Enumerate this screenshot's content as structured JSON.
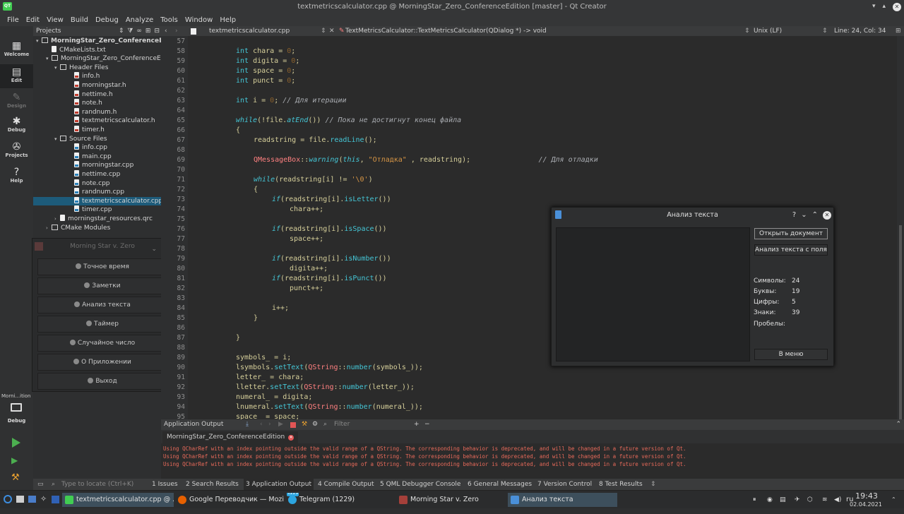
{
  "window": {
    "title": "textmetricscalculator.cpp @ MorningStar_Zero_ConferenceEdition [master] - Qt Creator",
    "logo": "QT"
  },
  "menu": [
    "File",
    "Edit",
    "View",
    "Build",
    "Debug",
    "Analyze",
    "Tools",
    "Window",
    "Help"
  ],
  "modes": [
    {
      "label": "Welcome",
      "icon": "▦"
    },
    {
      "label": "Edit",
      "icon": "▤"
    },
    {
      "label": "Design",
      "icon": "✎"
    },
    {
      "label": "Debug",
      "icon": "✱"
    },
    {
      "label": "Projects",
      "icon": "✇"
    },
    {
      "label": "Help",
      "icon": "?"
    }
  ],
  "run_side": {
    "target": "Morni...ition",
    "mode": "Debug"
  },
  "projects": {
    "header": "Projects",
    "rows": [
      {
        "text": "MorningStar_Zero_ConferenceE",
        "kind": "root"
      },
      {
        "text": "CMakeLists.txt",
        "kind": "file"
      },
      {
        "text": "MorningStar_Zero_ConferenceEd",
        "kind": "folder"
      },
      {
        "text": "Header Files",
        "kind": "folder"
      },
      {
        "text": "info.h",
        "kind": "h"
      },
      {
        "text": "morningstar.h",
        "kind": "h"
      },
      {
        "text": "nettime.h",
        "kind": "h"
      },
      {
        "text": "note.h",
        "kind": "h"
      },
      {
        "text": "randnum.h",
        "kind": "h"
      },
      {
        "text": "textmetricscalculator.h",
        "kind": "h"
      },
      {
        "text": "timer.h",
        "kind": "h"
      },
      {
        "text": "Source Files",
        "kind": "folder"
      },
      {
        "text": "info.cpp",
        "kind": "c"
      },
      {
        "text": "main.cpp",
        "kind": "c"
      },
      {
        "text": "morningstar.cpp",
        "kind": "c"
      },
      {
        "text": "nettime.cpp",
        "kind": "c"
      },
      {
        "text": "note.cpp",
        "kind": "c"
      },
      {
        "text": "randnum.cpp",
        "kind": "c"
      },
      {
        "text": "textmetricscalculator.cpp",
        "kind": "c",
        "selected": true
      },
      {
        "text": "timer.cpp",
        "kind": "c"
      },
      {
        "text": "morningstar_resources.qrc",
        "kind": "file"
      },
      {
        "text": "CMake Modules",
        "kind": "folder"
      }
    ]
  },
  "morningstar": {
    "title": "Morning Star v. Zero",
    "buttons": [
      "Точное время",
      "Заметки",
      "Анализ текста",
      "Таймер",
      "Случайное число",
      "О Приложении",
      "Выход"
    ]
  },
  "editor": {
    "file": "textmetricscalculator.cpp",
    "symbol": "TextMetricsCalculator::TextMetricsCalculator(QDialog *) -> void",
    "encoding": "Unix (LF)",
    "position": "Line: 24, Col: 34",
    "line_numbers": [
      "57",
      "58",
      "59",
      "60",
      "61",
      "62",
      "63",
      "64",
      "65",
      "66",
      "67",
      "68",
      "69",
      "70",
      "71",
      "72",
      "73",
      "74",
      "75",
      "76",
      "77",
      "78",
      "79",
      "80",
      "81",
      "82",
      "83",
      "84",
      "85",
      "86",
      "87",
      "88",
      "89",
      "90",
      "91",
      "92",
      "93",
      "94",
      "95"
    ]
  },
  "dialog": {
    "title": "Анализ текста",
    "btn_open": "Открыть документ",
    "btn_analyze": "Анализ текста с поля",
    "btn_menu": "В меню",
    "stats": [
      {
        "label": "Символы:",
        "value": "24"
      },
      {
        "label": "Буквы:",
        "value": "19"
      },
      {
        "label": "Цифры:",
        "value": "5"
      },
      {
        "label": "Знаки:",
        "value": "39"
      },
      {
        "label": "Пробелы:",
        "value": ""
      }
    ]
  },
  "output": {
    "header": "Application Output",
    "filter": "Filter",
    "tab": "MorningStar_Zero_ConferenceEdition",
    "lines": [
      "Using QCharRef with an index pointing outside the valid range of a QString. The corresponding behavior is deprecated, and will be changed in a future version of Qt.",
      "Using QCharRef with an index pointing outside the valid range of a QString. The corresponding behavior is deprecated, and will be changed in a future version of Qt.",
      "Using QCharRef with an index pointing outside the valid range of a QString. The corresponding behavior is deprecated, and will be changed in a future version of Qt."
    ]
  },
  "status": {
    "locate": "Type to locate (Ctrl+K)",
    "panes": [
      "1 Issues",
      "2 Search Results",
      "3 Application Output",
      "4 Compile Output",
      "5 QML Debugger Console",
      "6 General Messages",
      "7 Version Control",
      "8 Test Results"
    ]
  },
  "taskbar": {
    "tasks": [
      "textmetricscalculator.cpp @ ...",
      "Google Переводчик — Mozil...",
      "Telegram (1229)",
      "Morning Star v. Zero",
      "Анализ текста"
    ],
    "badge": "1229",
    "lang": "ru",
    "time": "19:43",
    "date": "02.04.2021"
  }
}
